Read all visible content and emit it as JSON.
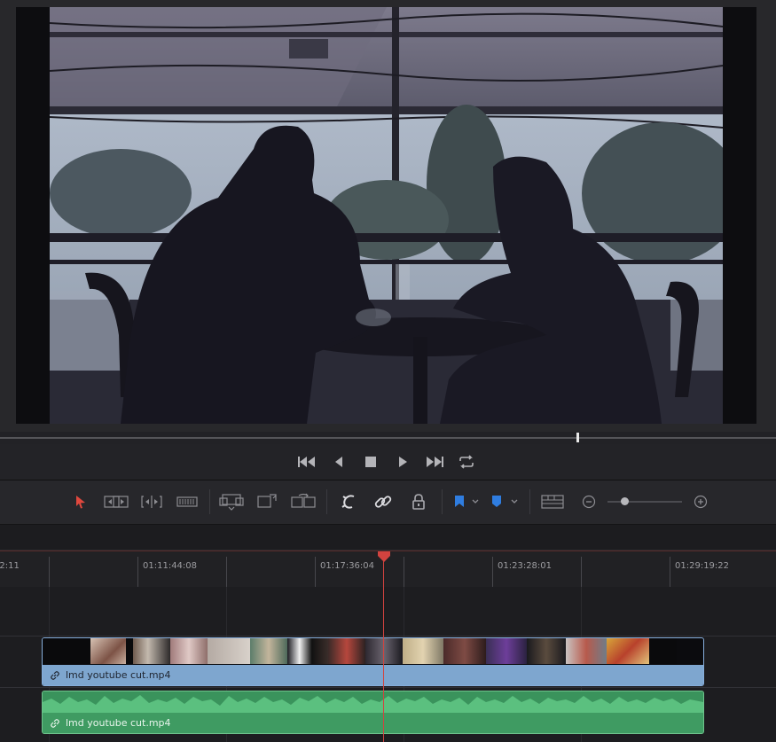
{
  "timeline": {
    "ruler_labels": [
      {
        "text": ":2:11"
      },
      {
        "text": "01:11:44:08"
      },
      {
        "text": "01:17:36:04"
      },
      {
        "text": "01:23:28:01"
      },
      {
        "text": "01:29:19:22"
      }
    ],
    "video_clip_name": "lmd youtube cut.mp4",
    "audio_clip_name": "lmd youtube cut.mp4"
  },
  "colors": {
    "accent_playhead": "#d2433f",
    "video_clip": "#7ea6cf",
    "audio_clip": "#3f9b62",
    "marker_blue": "#2f7de0"
  },
  "icons": {
    "transport": [
      "skip-to-start-icon",
      "step-back-icon",
      "stop-icon",
      "play-icon",
      "skip-to-end-icon",
      "loop-icon"
    ],
    "toolbar": [
      "selection-pointer-icon",
      "trim-tool-icon",
      "dynamic-trim-icon",
      "blade-tool-icon",
      "insert-clip-icon",
      "overwrite-clip-icon",
      "replace-clip-icon",
      "snapping-icon",
      "linked-selection-icon",
      "position-lock-icon",
      "flag-icon",
      "marker-icon",
      "timeline-view-options-icon",
      "zoom-out-icon",
      "zoom-in-icon"
    ]
  }
}
